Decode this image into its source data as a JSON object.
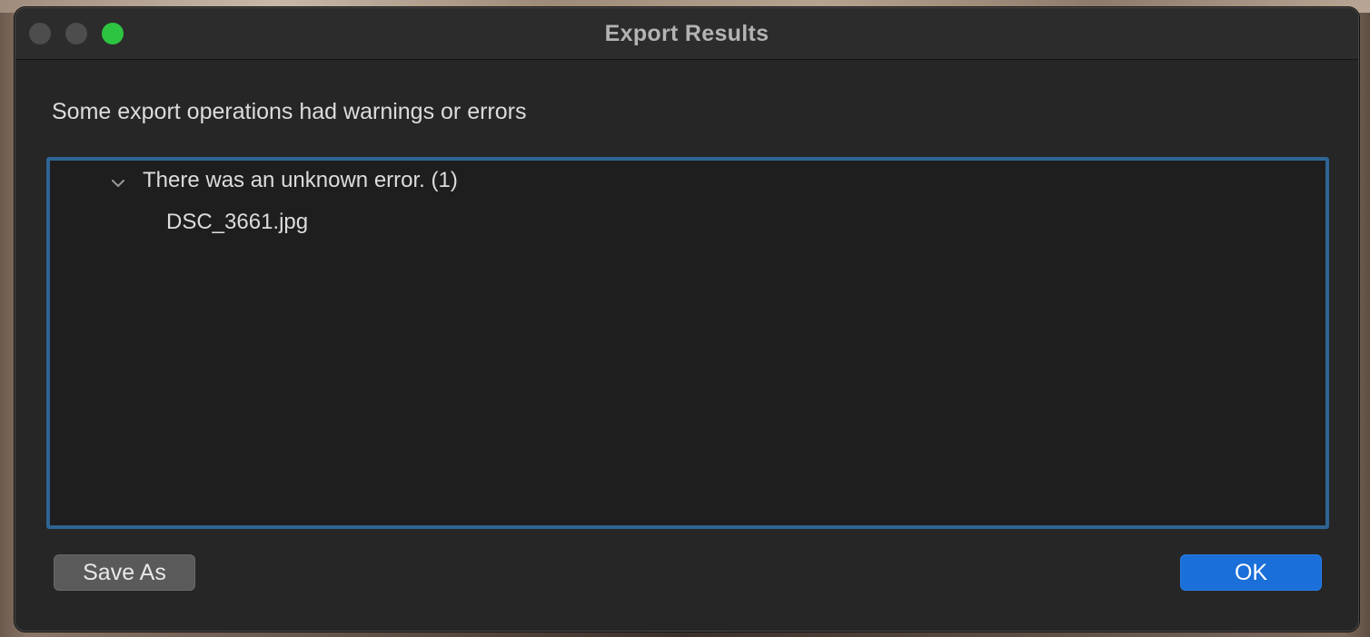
{
  "window": {
    "title": "Export Results"
  },
  "message": "Some export operations had warnings or errors",
  "results": {
    "groups": [
      {
        "label": "There was an unknown error. (1)",
        "expanded": true,
        "icon": "chevron-down-icon",
        "items": [
          "DSC_3661.jpg"
        ]
      }
    ],
    "border_color": "#2e6594"
  },
  "buttons": {
    "save_as": "Save As",
    "ok": "OK"
  },
  "colors": {
    "accent": "#1a6fd8",
    "zoom_button": "#2dc441"
  }
}
